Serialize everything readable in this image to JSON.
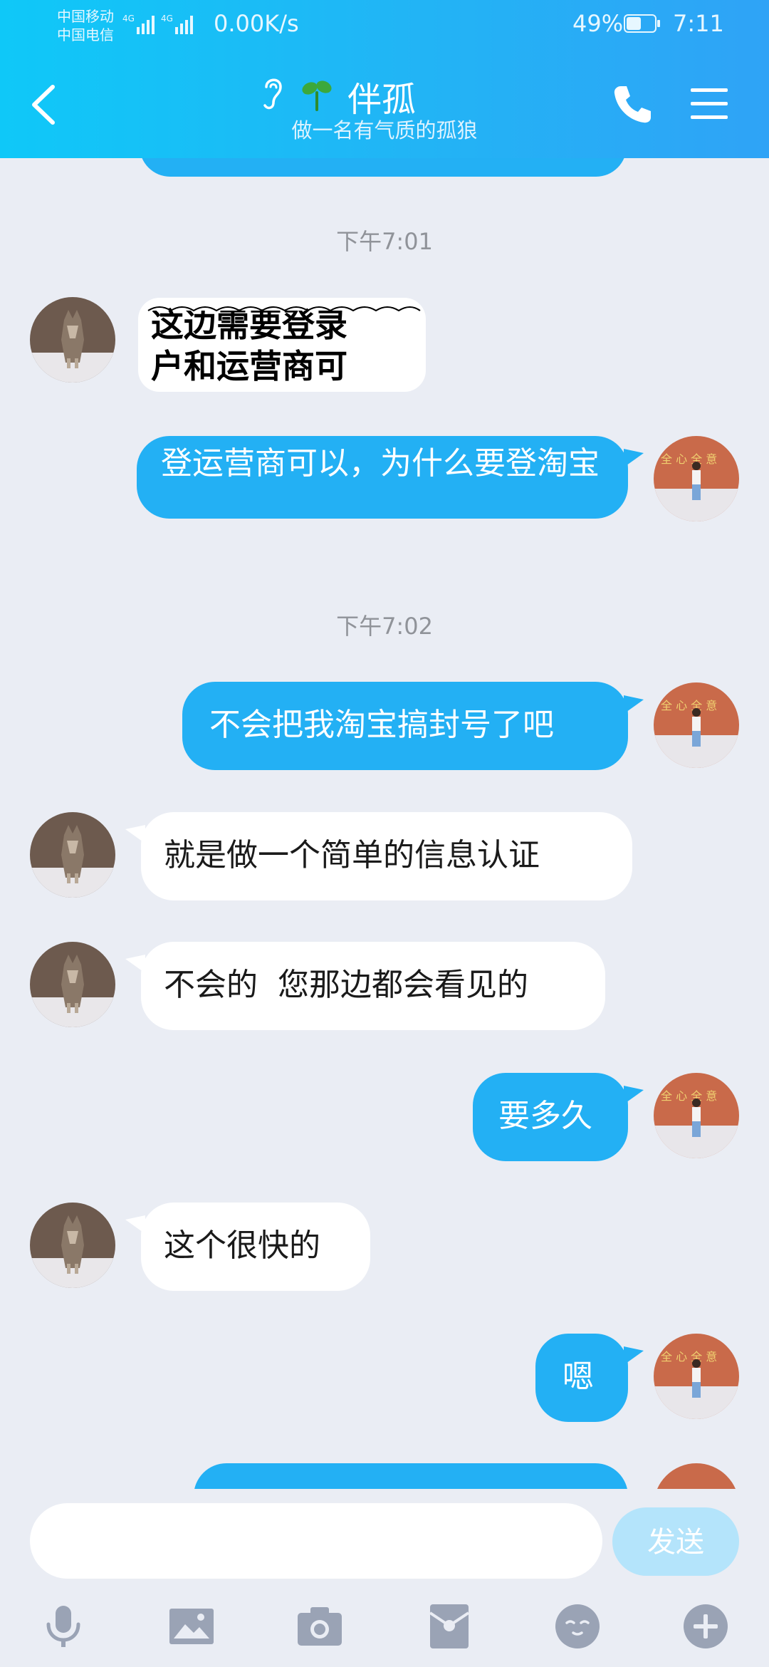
{
  "status_bar": {
    "carrier1": "中国移动",
    "carrier2": "中国电信",
    "net1": "4G",
    "net2": "4G",
    "speed": "0.00K/s",
    "battery": "49%",
    "time": "7:11"
  },
  "header": {
    "title": "伴孤",
    "subtitle": "做一名有气质的孤狼"
  },
  "messages": {
    "ts1": "下午7:01",
    "sticker_text": [
      "这边需要登录",
      "户和运营商可"
    ],
    "m2": "登运营商可以，为什么要登淘宝",
    "ts2": "下午7:02",
    "m3": "不会把我淘宝搞封号了吧",
    "m4": "就是做一个简单的信息认证",
    "m5": "不会的  您那边都会看见的",
    "m6": "要多久",
    "m7": "这个很快的",
    "m8": "嗯"
  },
  "input": {
    "placeholder": "",
    "send_label": "发送"
  },
  "toolbar": [
    "mic-icon",
    "image-icon",
    "camera-icon",
    "red-packet-icon",
    "emoji-icon",
    "plus-icon"
  ],
  "colors": {
    "header_start": "#0fc8f8",
    "header_end": "#2fa3f6",
    "outgoing_bubble": "#23b0f4",
    "incoming_bubble": "#ffffff",
    "background": "#eaedf4",
    "send_button": "#b4e4fb"
  }
}
